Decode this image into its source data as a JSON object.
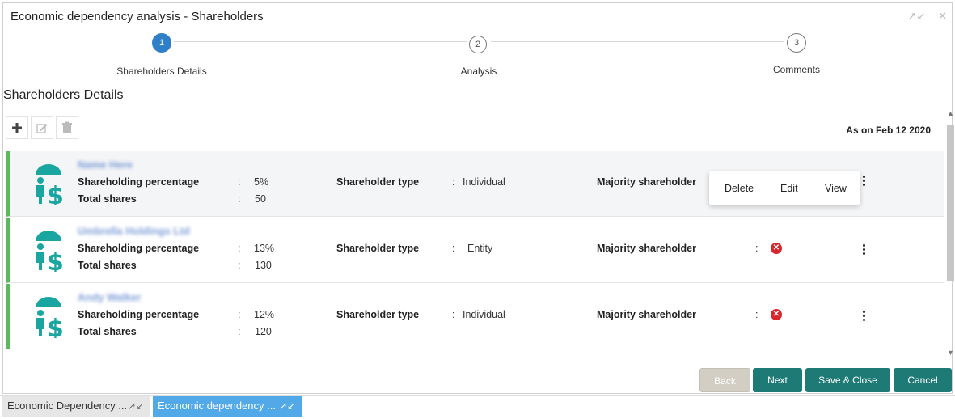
{
  "window": {
    "title": "Economic dependency analysis - Shareholders",
    "icons": [
      "collapse-icon",
      "close-icon"
    ]
  },
  "stepper": {
    "steps": [
      {
        "number": "1",
        "label": "Shareholders Details",
        "active": true
      },
      {
        "number": "2",
        "label": "Analysis",
        "active": false
      },
      {
        "number": "3",
        "label": "Comments",
        "active": false
      }
    ]
  },
  "section_title": "Shareholders Details",
  "toolbar": {
    "icons": [
      "add-icon",
      "edit-icon",
      "delete-icon"
    ]
  },
  "as_on": "As on Feb 12 2020",
  "labels": {
    "shareholding_percentage": "Shareholding percentage",
    "total_shares": "Total shares",
    "shareholder_type": "Shareholder type",
    "majority_shareholder": "Majority shareholder",
    "colon": ":"
  },
  "rows": [
    {
      "name": "Name Here",
      "percentage": "5%",
      "total_shares": "50",
      "type": "Individual",
      "majority": "",
      "selected": true
    },
    {
      "name": "Umbrella Holdings Ltd",
      "percentage": "13%",
      "total_shares": "130",
      "type": "Entity",
      "majority": "no"
    },
    {
      "name": "Andy Walker",
      "percentage": "12%",
      "total_shares": "120",
      "type": "Individual",
      "majority": "no"
    }
  ],
  "popup_menu": {
    "items": [
      "Delete",
      "Edit",
      "View"
    ]
  },
  "buttons": {
    "back": "Back",
    "next": "Next",
    "save_close": "Save & Close",
    "cancel": "Cancel"
  },
  "taskbar": {
    "tabs": [
      {
        "label": "Economic Dependency ...",
        "active": false
      },
      {
        "label": "Economic dependency ...",
        "active": true
      }
    ]
  },
  "colors": {
    "accent": "#2f80c9",
    "teal": "#1e7a74",
    "row_marker": "#5cb85c",
    "icon_teal": "#19a6a0",
    "error": "#d9262c"
  }
}
